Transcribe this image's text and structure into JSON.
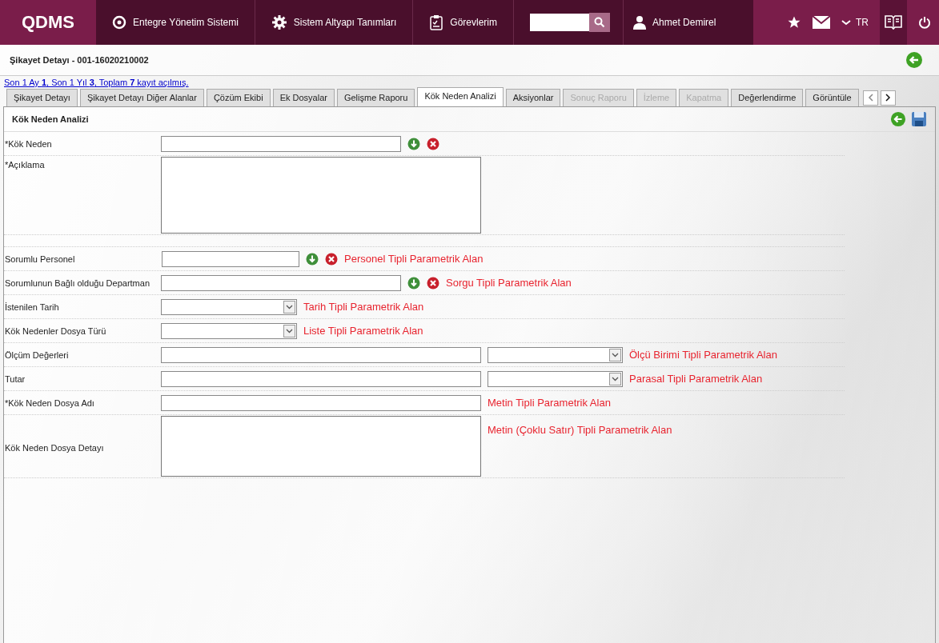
{
  "header": {
    "logo": "QDMS",
    "nav": [
      {
        "label": "Entegre Yönetim Sistemi"
      },
      {
        "label": "Sistem Altyapı Tanımları"
      },
      {
        "label": "Görevlerim"
      }
    ],
    "user": "Ahmet Demirel",
    "language": "TR"
  },
  "page": {
    "title": "Şikayet Detayı - 001-16020210002",
    "record_info": "Son 1 Ay **1**, Son 1 Yıl **3**, Toplam **7** kayıt açılmış."
  },
  "tabs": [
    {
      "label": "Şikayet Detayı",
      "selected": false,
      "disabled": false
    },
    {
      "label": "Şikayet Detayı Diğer Alanlar",
      "selected": false,
      "disabled": false
    },
    {
      "label": "Çözüm Ekibi",
      "selected": false,
      "disabled": false
    },
    {
      "label": "Ek Dosyalar",
      "selected": false,
      "disabled": false
    },
    {
      "label": "Gelişme Raporu",
      "selected": false,
      "disabled": false
    },
    {
      "label": "Kök Neden Analizi",
      "selected": true,
      "disabled": false
    },
    {
      "label": "Aksiyonlar",
      "selected": false,
      "disabled": false
    },
    {
      "label": "Sonuç Raporu",
      "selected": false,
      "disabled": true
    },
    {
      "label": "İzleme",
      "selected": false,
      "disabled": true
    },
    {
      "label": "Kapatma",
      "selected": false,
      "disabled": true
    },
    {
      "label": "Değerlendirme",
      "selected": false,
      "disabled": false
    },
    {
      "label": "Görüntüle",
      "selected": false,
      "disabled": false
    }
  ],
  "section": {
    "title": "Kök Neden Analizi"
  },
  "fields": [
    {
      "kind": "lookup",
      "label": "*Kök Neden"
    },
    {
      "kind": "textarea",
      "label": "*Açıklama"
    },
    {
      "kind": "person",
      "label": "Sorumlu Personel",
      "note": "Personel Tipli Parametrik Alan"
    },
    {
      "kind": "lookup",
      "label": "Sorumlunun Bağlı olduğu Departman",
      "note": "Sorgu Tipli Parametrik Alan"
    },
    {
      "kind": "date",
      "label": "İstenilen Tarih",
      "note": "Tarih Tipli Parametrik Alan"
    },
    {
      "kind": "list",
      "label": "Kök Nedenler Dosya Türü",
      "note": "Liste Tipli Parametrik Alan"
    },
    {
      "kind": "measure",
      "label": "Ölçüm Değerleri",
      "note": "Ölçü Birimi Tipli Parametrik Alan"
    },
    {
      "kind": "measure",
      "label": "Tutar",
      "note": "Parasal Tipli Parametrik Alan"
    },
    {
      "kind": "text",
      "label": "*Kök Neden Dosya Adı",
      "note": "Metin Tipli Parametrik Alan"
    },
    {
      "kind": "memo",
      "label": "Kök Neden Dosya Detayı",
      "note": "Metin (Çoklu Satır) Tipli Parametrik Alan"
    }
  ]
}
